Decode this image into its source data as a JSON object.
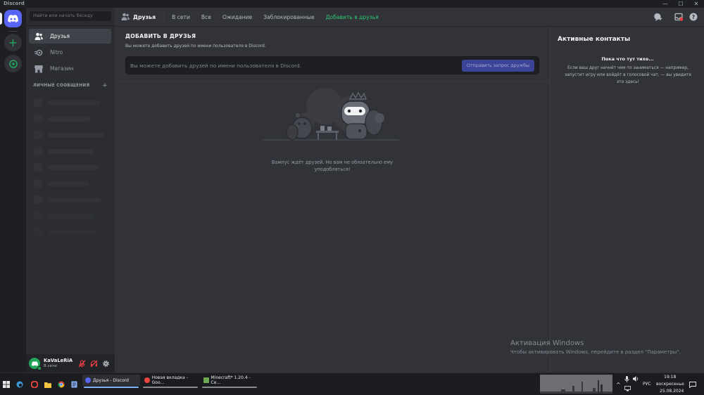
{
  "window": {
    "title": "Discord"
  },
  "sidebar": {
    "search_placeholder": "Найти или начать беседу",
    "nav": [
      {
        "label": "Друзья",
        "icon": "friends-icon"
      },
      {
        "label": "Nitro",
        "icon": "nitro-icon"
      },
      {
        "label": "Магазин",
        "icon": "shop-icon"
      }
    ],
    "dm_header": "ЛИЧНЫЕ СООБЩЕНИЯ",
    "dm_add": "+"
  },
  "user": {
    "name": "KaVaLeRiA",
    "status": "В сети"
  },
  "topbar": {
    "title": "Друзья",
    "tabs": [
      "В сети",
      "Все",
      "Ожидание",
      "Заблокированные",
      "Добавить в друзья"
    ]
  },
  "add_friend": {
    "title": "ДОБАВИТЬ В ДРУЗЬЯ",
    "description": "Вы можете добавить друзей по имени пользователя в Discord.",
    "input_placeholder": "Вы можете добавить друзей по имени пользователя в Discord.",
    "button": "Отправить запрос дружбы"
  },
  "empty_state": {
    "text": "Вампус ждёт друзей. Но вам не обязательно ему уподобляться!"
  },
  "active_now": {
    "title": "Активные контакты",
    "subtitle": "Пока что тут тихо...",
    "text": "Если ваш друг начнёт чем-то заниматься — например, запустит игру или войдёт в голосовой чат, — вы увидите это здесь!"
  },
  "watermark": {
    "title": "Активация Windows",
    "text": "Чтобы активировать Windows, перейдите в раздел \"Параметры\"."
  },
  "taskbar": {
    "items": [
      {
        "label": "Друзья - Discord",
        "color": "#5865f2"
      },
      {
        "label": "Новая вкладка - Goo...",
        "color": "#e8453c"
      },
      {
        "label": "Minecraft* 1.20.4 - Се...",
        "color": "#6aa84f"
      }
    ],
    "lang": "РУС",
    "time": "19:18",
    "day": "воскресенье",
    "date": "25.08.2024"
  },
  "colors": {
    "accent": "#5865f2",
    "green": "#23a55a",
    "add_tab": "#2dc770"
  }
}
